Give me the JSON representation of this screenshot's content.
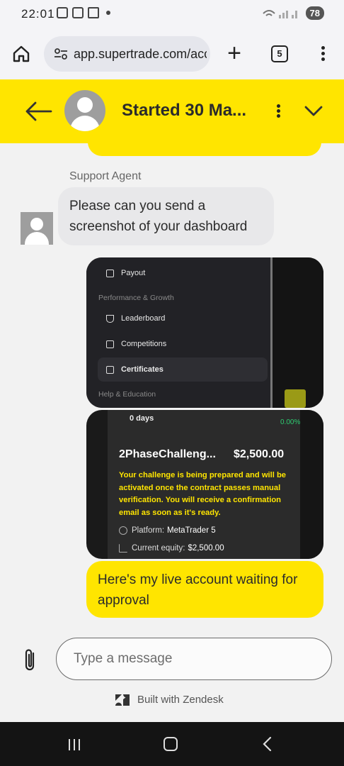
{
  "status_bar": {
    "time": "22:01",
    "battery": "78"
  },
  "browser": {
    "url": "app.supertrade.com/acco",
    "tab_count": "5"
  },
  "header": {
    "title": "Started 30 Ma..."
  },
  "chat": {
    "agent_name": "Support Agent",
    "agent_message": "Please can you send a screenshot of your dashboard",
    "screenshot1": {
      "payout": "Payout",
      "section1": "Performance & Growth",
      "leaderboard": "Leaderboard",
      "competitions": "Competitions",
      "certificates": "Certificates",
      "section2": "Help & Education"
    },
    "screenshot2": {
      "days": "0 days",
      "percent": "0.00%",
      "challenge_title": "2PhaseChalleng...",
      "amount": "$2,500.00",
      "notice": "Your challenge is being prepared and will be activated once the contract passes manual verification. You will receive a confirmation email as soon as it's ready.",
      "platform_label": "Platform:",
      "platform_value": "MetaTrader 5",
      "equity_label": "Current equity:",
      "equity_value": "$2,500.00"
    },
    "user_message": "Here's my live account waiting for approval"
  },
  "composer": {
    "placeholder": "Type a message",
    "built_with": "Built with Zendesk"
  },
  "colors": {
    "accent": "#ffe500",
    "bubble_agent": "#e8e8ea",
    "nav_bg": "#141414"
  }
}
